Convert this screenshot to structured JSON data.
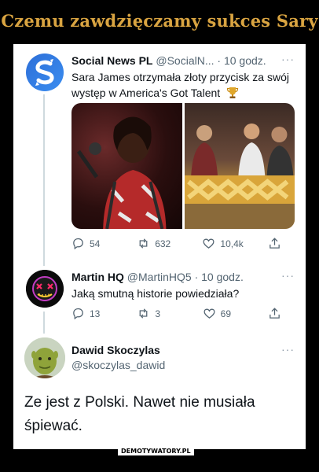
{
  "meme": {
    "title": "Czemu zawdzięczamy sukces Sary",
    "watermark": "DEMOTYWATORY.PL",
    "caption_line1": "Ze jest z Polski. Nawet nie musiała",
    "caption_line2": "śpiewać."
  },
  "tweets": [
    {
      "name": "Social News PL",
      "handle": "@SocialN...",
      "time": "· 10 godz.",
      "text": "Sara James otrzymała złoty przycisk za swój występ w America's Got Talent",
      "emoji": "trophy-icon",
      "stats": {
        "replies": "54",
        "retweets": "632",
        "likes": "10,4k"
      }
    },
    {
      "name": "Martin HQ",
      "handle": "@MartinHQ5",
      "time": "· 10 godz.",
      "text": "Jaką smutną historie powiedziała?",
      "stats": {
        "replies": "13",
        "retweets": "3",
        "likes": "69"
      }
    },
    {
      "name": "Dawid Skoczylas",
      "handle": "@skoczylas_dawid"
    }
  ],
  "more_label": "···",
  "colors": {
    "title": "#d9a441",
    "twitter_gray": "#536471",
    "brand_blue": "#2e6fd8"
  }
}
